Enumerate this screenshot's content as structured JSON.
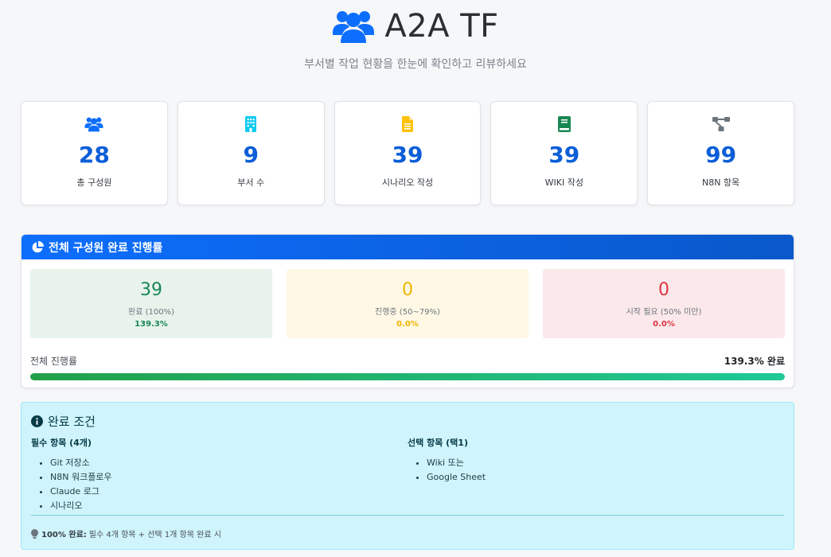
{
  "header": {
    "title": "A2A TF",
    "subtitle": "부서별 작업 현황을 한눈에 확인하고 리뷰하세요",
    "icon": "users-icon"
  },
  "stats": [
    {
      "icon": "users-icon",
      "color": "#0d6efd",
      "value": "28",
      "label": "총 구성원"
    },
    {
      "icon": "building-icon",
      "color": "#0dcaf0",
      "value": "9",
      "label": "부서 수"
    },
    {
      "icon": "document-icon",
      "color": "#ffc107",
      "value": "39",
      "label": "시나리오 작성"
    },
    {
      "icon": "book-icon",
      "color": "#198754",
      "value": "39",
      "label": "WIKI 작성"
    },
    {
      "icon": "diagram-icon",
      "color": "#6c757d",
      "value": "99",
      "label": "N8N 항목"
    }
  ],
  "progress": {
    "title": "전체 구성원 완료 진행률",
    "boxes": [
      {
        "count": "39",
        "label": "완료 (100%)",
        "percent": "139.3%"
      },
      {
        "count": "0",
        "label": "진행중 (50~79%)",
        "percent": "0.0%"
      },
      {
        "count": "0",
        "label": "시작 필요 (50% 미만)",
        "percent": "0.0%"
      }
    ],
    "overall_label": "전체 진행률",
    "overall_value": "139.3% 완료",
    "bar_fill": 1.0
  },
  "conditions": {
    "title": "완료 조건",
    "required_title": "필수 항목 (4개)",
    "required_items": [
      "Git 저장소",
      "N8N 워크플로우",
      "Claude 로그",
      "시나리오"
    ],
    "optional_title": "선택 항목 (택1)",
    "optional_items": [
      "Wiki 또는",
      "Google Sheet"
    ],
    "note_bold": "100% 완료:",
    "note_text": "필수 4개 항목 + 선택 1개 항목 완료 시"
  },
  "colors": {
    "primary": "#0d6efd",
    "success": "#198754",
    "warning": "#ffc107",
    "danger": "#dc3545",
    "info_bg": "#cff4fc"
  }
}
